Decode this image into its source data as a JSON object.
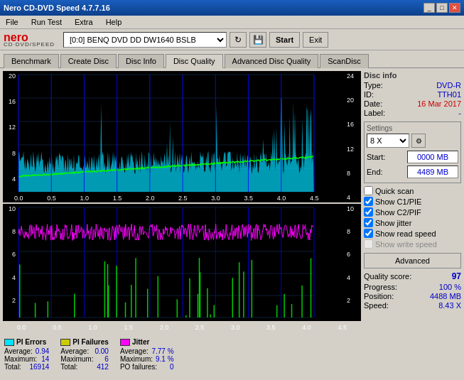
{
  "window": {
    "title": "Nero CD-DVD Speed 4.7.7.16",
    "titleButtons": [
      "_",
      "□",
      "✕"
    ]
  },
  "menu": {
    "items": [
      "File",
      "Run Test",
      "Extra",
      "Help"
    ]
  },
  "toolbar": {
    "logo_top": "nero",
    "logo_bottom": "CD·DVD/SPEED",
    "drive_label": "[0:0]  BENQ DVD DD DW1640 BSLB",
    "start_label": "Start",
    "exit_label": "Exit"
  },
  "tabs": [
    {
      "label": "Benchmark",
      "active": false
    },
    {
      "label": "Create Disc",
      "active": false
    },
    {
      "label": "Disc Info",
      "active": false
    },
    {
      "label": "Disc Quality",
      "active": true
    },
    {
      "label": "Advanced Disc Quality",
      "active": false
    },
    {
      "label": "ScanDisc",
      "active": false
    }
  ],
  "discInfo": {
    "type_label": "Type:",
    "type_value": "DVD-R",
    "id_label": "ID:",
    "id_value": "TTH01",
    "date_label": "Date:",
    "date_value": "16 Mar 2017",
    "label_label": "Label:",
    "label_value": "-"
  },
  "settings": {
    "title": "Settings",
    "speed_value": "8 X",
    "start_label": "Start:",
    "start_value": "0000 MB",
    "end_label": "End:",
    "end_value": "4489 MB",
    "checkboxes": [
      {
        "label": "Quick scan",
        "checked": false
      },
      {
        "label": "Show C1/PIE",
        "checked": true
      },
      {
        "label": "Show C2/PIF",
        "checked": true
      },
      {
        "label": "Show jitter",
        "checked": true
      },
      {
        "label": "Show read speed",
        "checked": true
      },
      {
        "label": "Show write speed",
        "checked": false,
        "disabled": true
      }
    ],
    "advanced_label": "Advanced"
  },
  "quality": {
    "score_label": "Quality score:",
    "score_value": "97"
  },
  "progress": {
    "progress_label": "Progress:",
    "progress_value": "100 %",
    "position_label": "Position:",
    "position_value": "4488 MB",
    "speed_label": "Speed:",
    "speed_value": "8.43 X"
  },
  "stats": {
    "pi_errors": {
      "title": "PI Errors",
      "color": "#00ffff",
      "average_label": "Average:",
      "average_value": "0.94",
      "maximum_label": "Maximum:",
      "maximum_value": "14",
      "total_label": "Total:",
      "total_value": "16914"
    },
    "pi_failures": {
      "title": "PI Failures",
      "color": "#cccc00",
      "average_label": "Average:",
      "average_value": "0.00",
      "maximum_label": "Maximum:",
      "maximum_value": "6",
      "total_label": "Total:",
      "total_value": "412"
    },
    "jitter": {
      "title": "Jitter",
      "color": "#ff00ff",
      "average_label": "Average:",
      "average_value": "7.77 %",
      "maximum_label": "Maximum:",
      "maximum_value": "9.1 %",
      "po_label": "PO failures:",
      "po_value": "0"
    }
  },
  "chart": {
    "top": {
      "y_max": 20,
      "y_right_max": 24,
      "x_labels": [
        "0.0",
        "0.5",
        "1.0",
        "1.5",
        "2.0",
        "2.5",
        "3.0",
        "3.5",
        "4.0",
        "4.5"
      ]
    },
    "bottom": {
      "y_max": 10,
      "y_right_max": 10,
      "x_labels": [
        "0.0",
        "0.5",
        "1.0",
        "1.5",
        "2.0",
        "2.5",
        "3.0",
        "3.5",
        "4.0",
        "4.5"
      ]
    }
  }
}
